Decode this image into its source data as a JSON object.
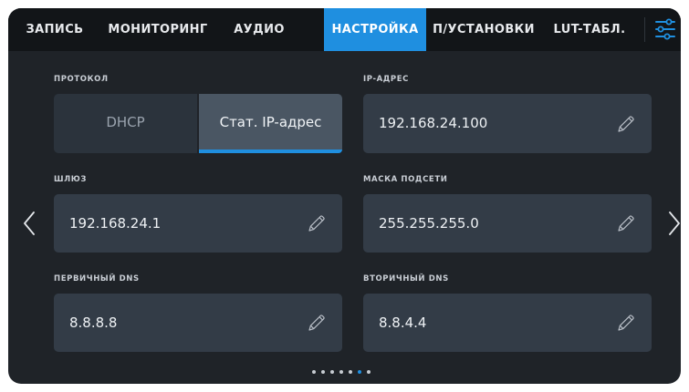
{
  "tabs": [
    {
      "label": "ЗАПИСЬ",
      "active": false
    },
    {
      "label": "МОНИТОРИНГ",
      "active": false
    },
    {
      "label": "АУДИО",
      "active": false
    },
    {
      "label": "НАСТРОЙКА",
      "active": true
    },
    {
      "label": "П/УСТАНОВКИ",
      "active": false
    },
    {
      "label": "LUT-ТАБЛ.",
      "active": false
    }
  ],
  "menu_icon": "sliders-icon",
  "protocol": {
    "label": "ПРОТОКОЛ",
    "options": [
      "DHCP",
      "Стат. IP-адрес"
    ],
    "selected": "Стат. IP-адрес"
  },
  "fields": {
    "ip": {
      "label": "IP-АДРЕС",
      "value": "192.168.24.100",
      "icon": "pencil-icon"
    },
    "gateway": {
      "label": "ШЛЮЗ",
      "value": "192.168.24.1",
      "icon": "pencil-icon"
    },
    "subnet": {
      "label": "МАСКА ПОДСЕТИ",
      "value": "255.255.255.0",
      "icon": "pencil-icon"
    },
    "dns1": {
      "label": "ПЕРВИЧНЫЙ DNS",
      "value": "8.8.8.8",
      "icon": "pencil-icon"
    },
    "dns2": {
      "label": "ВТОРИЧНЫЙ DNS",
      "value": "8.8.4.4",
      "icon": "pencil-icon"
    }
  },
  "nav": {
    "prev_icon": "chevron-left-icon",
    "next_icon": "chevron-right-icon"
  },
  "pagination": {
    "total": 7,
    "current": 6
  },
  "colors": {
    "accent": "#1f8fe0",
    "background": "#1f2328",
    "tabbar": "#121518",
    "field": "#333c47"
  }
}
